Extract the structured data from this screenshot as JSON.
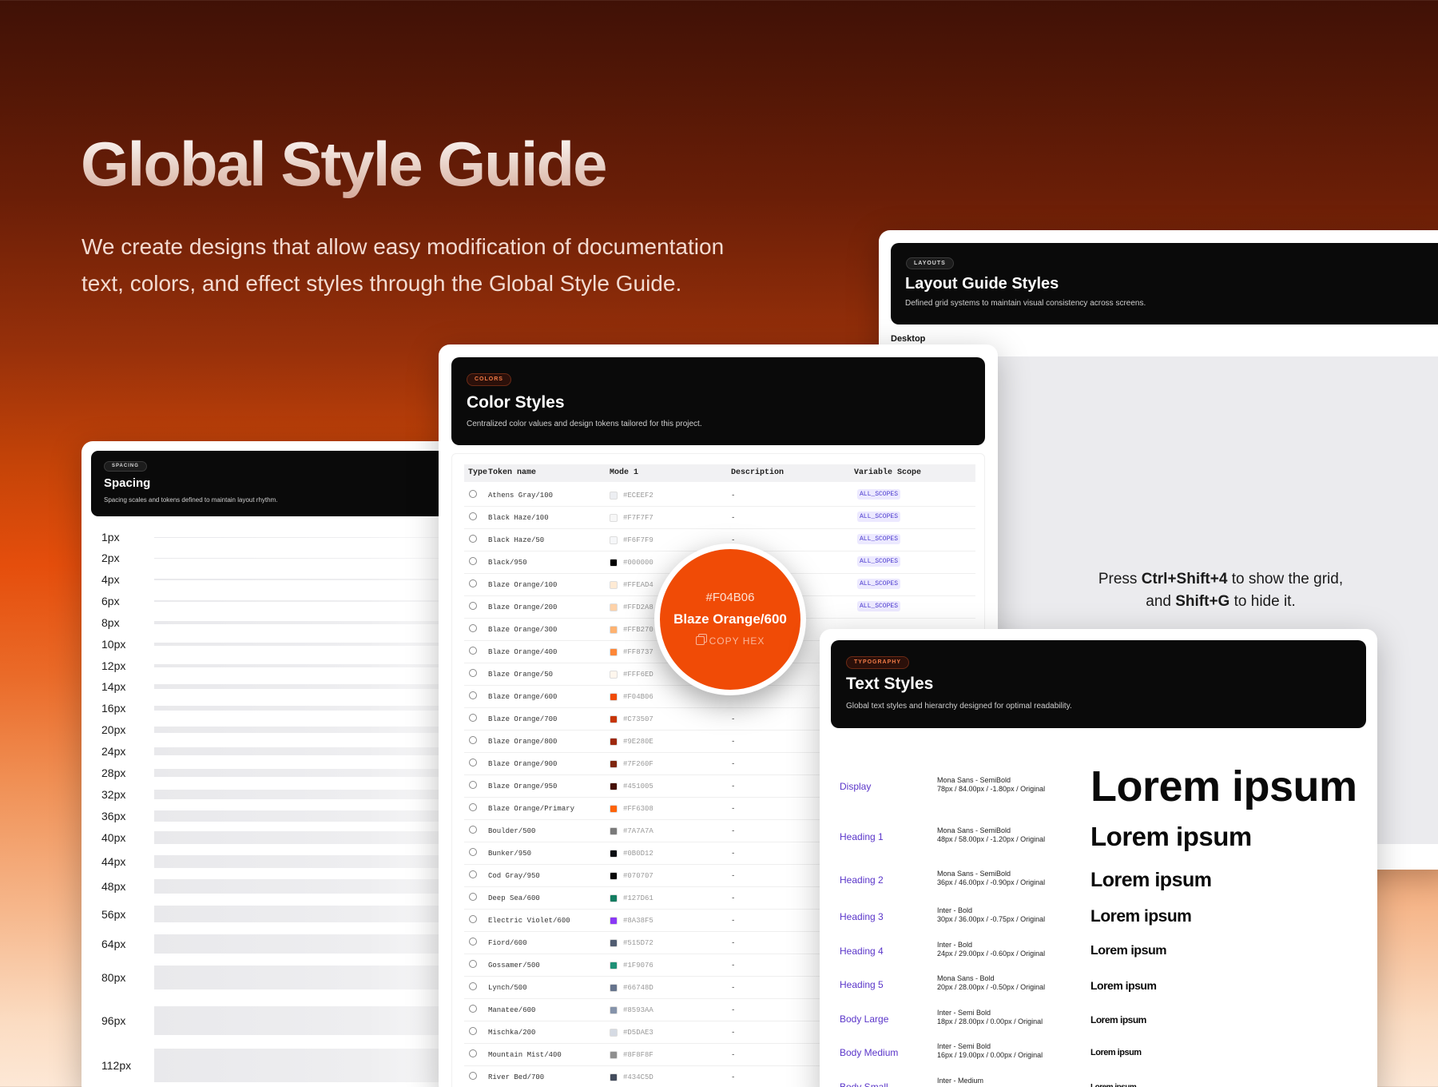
{
  "hero": {
    "title": "Global Style Guide",
    "subtitle": "We create designs that allow easy modification of documentation text, colors, and effect styles through the Global Style Guide."
  },
  "layout_card": {
    "chip": "LAYOUTS",
    "title": "Layout Guide Styles",
    "description": "Defined grid systems to maintain visual consistency across screens.",
    "section": "Desktop",
    "hint_pre": "Press ",
    "hint_key1": "Ctrl+Shift+4",
    "hint_mid": " to show the grid, and ",
    "hint_key2": "Shift+G",
    "hint_post": " to hide it."
  },
  "spacing_card": {
    "chip": "SPACING",
    "title": "Spacing",
    "description": "Spacing scales and tokens defined to maintain layout rhythm.",
    "items": [
      {
        "label": "1px",
        "value": 1
      },
      {
        "label": "2px",
        "value": 2
      },
      {
        "label": "4px",
        "value": 4
      },
      {
        "label": "6px",
        "value": 6
      },
      {
        "label": "8px",
        "value": 8
      },
      {
        "label": "10px",
        "value": 10
      },
      {
        "label": "12px",
        "value": 12
      },
      {
        "label": "14px",
        "value": 14
      },
      {
        "label": "16px",
        "value": 16
      },
      {
        "label": "20px",
        "value": 20
      },
      {
        "label": "24px",
        "value": 24
      },
      {
        "label": "28px",
        "value": 28
      },
      {
        "label": "32px",
        "value": 32
      },
      {
        "label": "36px",
        "value": 36
      },
      {
        "label": "40px",
        "value": 40
      },
      {
        "label": "44px",
        "value": 44
      },
      {
        "label": "48px",
        "value": 48
      },
      {
        "label": "56px",
        "value": 56
      },
      {
        "label": "64px",
        "value": 64
      },
      {
        "label": "80px",
        "value": 80
      },
      {
        "label": "96px",
        "value": 96
      },
      {
        "label": "112px",
        "value": 112
      }
    ]
  },
  "color_card": {
    "chip": "COLORS",
    "title": "Color Styles",
    "description": "Centralized color values and design tokens tailored for this project.",
    "columns": {
      "type": "Type",
      "token": "Token name",
      "mode": "Mode 1",
      "description": "Description",
      "scope": "Variable Scope"
    },
    "rows": [
      {
        "token": "Athens Gray/100",
        "hex": "#ECEEF2",
        "desc": "-",
        "scope": "ALL_SCOPES"
      },
      {
        "token": "Black Haze/100",
        "hex": "#F7F7F7",
        "desc": "-",
        "scope": "ALL_SCOPES"
      },
      {
        "token": "Black Haze/50",
        "hex": "#F6F7F9",
        "desc": "-",
        "scope": "ALL_SCOPES"
      },
      {
        "token": "Black/950",
        "hex": "#000000",
        "desc": "-",
        "scope": "ALL_SCOPES"
      },
      {
        "token": "Blaze Orange/100",
        "hex": "#FFEAD4",
        "desc": "-",
        "scope": "ALL_SCOPES"
      },
      {
        "token": "Blaze Orange/200",
        "hex": "#FFD2A8",
        "desc": "-",
        "scope": "ALL_SCOPES"
      },
      {
        "token": "Blaze Orange/300",
        "hex": "#FFB270",
        "desc": "",
        "scope": ""
      },
      {
        "token": "Blaze Orange/400",
        "hex": "#FF8737",
        "desc": "",
        "scope": ""
      },
      {
        "token": "Blaze Orange/50",
        "hex": "#FFF6ED",
        "desc": "",
        "scope": ""
      },
      {
        "token": "Blaze Orange/600",
        "hex": "#F04B06",
        "desc": "",
        "scope": ""
      },
      {
        "token": "Blaze Orange/700",
        "hex": "#C73507",
        "desc": "-",
        "scope": ""
      },
      {
        "token": "Blaze Orange/800",
        "hex": "#9E280E",
        "desc": "-",
        "scope": ""
      },
      {
        "token": "Blaze Orange/900",
        "hex": "#7F260F",
        "desc": "-",
        "scope": ""
      },
      {
        "token": "Blaze Orange/950",
        "hex": "#451005",
        "desc": "-",
        "scope": ""
      },
      {
        "token": "Blaze Orange/Primary",
        "hex": "#FF6308",
        "desc": "-",
        "scope": ""
      },
      {
        "token": "Boulder/500",
        "hex": "#7A7A7A",
        "desc": "-",
        "scope": ""
      },
      {
        "token": "Bunker/950",
        "hex": "#0B0D12",
        "desc": "-",
        "scope": ""
      },
      {
        "token": "Cod Gray/950",
        "hex": "#070707",
        "desc": "-",
        "scope": ""
      },
      {
        "token": "Deep Sea/600",
        "hex": "#127D61",
        "desc": "-",
        "scope": ""
      },
      {
        "token": "Electric Violet/600",
        "hex": "#8A38F5",
        "desc": "-",
        "scope": ""
      },
      {
        "token": "Fiord/600",
        "hex": "#515D72",
        "desc": "-",
        "scope": ""
      },
      {
        "token": "Gossamer/500",
        "hex": "#1F9076",
        "desc": "-",
        "scope": ""
      },
      {
        "token": "Lynch/500",
        "hex": "#66748D",
        "desc": "-",
        "scope": ""
      },
      {
        "token": "Manatee/600",
        "hex": "#8593AA",
        "desc": "-",
        "scope": ""
      },
      {
        "token": "Mischka/200",
        "hex": "#D5DAE3",
        "desc": "-",
        "scope": ""
      },
      {
        "token": "Mountain Mist/400",
        "hex": "#8F8F8F",
        "desc": "-",
        "scope": ""
      },
      {
        "token": "River Bed/700",
        "hex": "#434C5D",
        "desc": "-",
        "scope": ""
      }
    ]
  },
  "popup": {
    "hex": "#F04B06",
    "name": "Blaze Orange/600",
    "copy_label": "COPY HEX"
  },
  "text_card": {
    "chip": "TYPOGRAPHY",
    "title": "Text Styles",
    "description": "Global text styles and hierarchy designed for optimal readability.",
    "rows": [
      {
        "name": "Display",
        "font": "Mona Sans - SemiBold",
        "spec": "78px / 84.00px / -1.80px / Original",
        "sample": "Lorem ipsum",
        "size": 54
      },
      {
        "name": "Heading 1",
        "font": "Mona Sans - SemiBold",
        "spec": "48px / 58.00px / -1.20px / Original",
        "sample": "Lorem ipsum",
        "size": 33
      },
      {
        "name": "Heading 2",
        "font": "Mona Sans - SemiBold",
        "spec": "36px / 46.00px / -0.90px / Original",
        "sample": "Lorem ipsum",
        "size": 25
      },
      {
        "name": "Heading 3",
        "font": "Inter - Bold",
        "spec": "30px / 36.00px / -0.75px / Original",
        "sample": "Lorem ipsum",
        "size": 21
      },
      {
        "name": "Heading 4",
        "font": "Inter - Bold",
        "spec": "24px / 29.00px / -0.60px / Original",
        "sample": "Lorem ipsum",
        "size": 16
      },
      {
        "name": "Heading 5",
        "font": "Mona Sans - Bold",
        "spec": "20px / 28.00px / -0.50px / Original",
        "sample": "Lorem ipsum",
        "size": 14
      },
      {
        "name": "Body Large",
        "font": "Inter - Semi Bold",
        "spec": "18px / 28.00px / 0.00px / Original",
        "sample": "Lorem ipsum",
        "size": 12
      },
      {
        "name": "Body Medium",
        "font": "Inter - Semi Bold",
        "spec": "16px / 19.00px / 0.00px / Original",
        "sample": "Lorem ipsum",
        "size": 11
      },
      {
        "name": "Body Small",
        "font": "Inter - Medium",
        "spec": "",
        "sample": "Lorem ipsum",
        "size": 10
      }
    ]
  },
  "colors": {
    "accent": "#F04B06",
    "violet": "#5A35C9"
  }
}
